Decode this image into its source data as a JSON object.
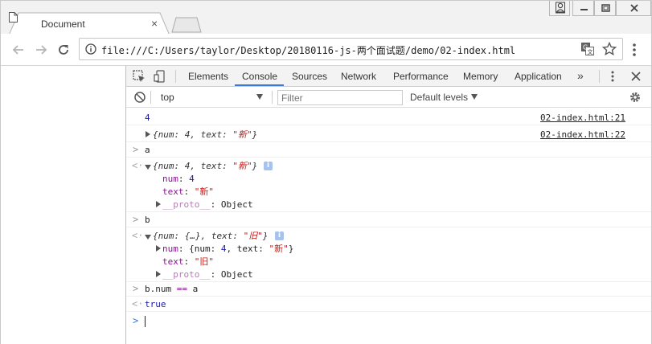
{
  "tab": {
    "title": "Document",
    "close": "×"
  },
  "address": {
    "url": "file:///C:/Users/taylor/Desktop/20180116-js-两个面试题/demo/02-index.html"
  },
  "icons": {
    "back": "arrow-left-icon",
    "forward": "arrow-right-icon",
    "reload": "reload-icon",
    "info": "info-icon",
    "translate": "translate-icon",
    "star": "star-icon",
    "menu": "kebab-menu-icon",
    "user": "user-icon",
    "minimize": "minimize-icon",
    "restore": "restore-icon",
    "close": "close-icon"
  },
  "devtools": {
    "tabs": [
      "Elements",
      "Console",
      "Sources",
      "Network",
      "Performance",
      "Memory",
      "Application"
    ],
    "active_tab": "Console",
    "more": "»",
    "context": "top",
    "filter_placeholder": "Filter",
    "levels": "Default levels"
  },
  "console": {
    "log1": {
      "value": "4",
      "source": "02-index.html:21"
    },
    "log2": {
      "text_prefix": "{num: 4, text: ",
      "text_str": "\"新\"",
      "text_suffix": "}",
      "source": "02-index.html:22"
    },
    "cmd_a": "a",
    "res_a": {
      "summary_prefix": "{num: 4, text: ",
      "summary_str": "\"新\"",
      "summary_suffix": "}",
      "badge": "i",
      "prop_num_key": "num",
      "prop_num_val": "4",
      "prop_text_key": "text",
      "prop_text_val": "\"新\"",
      "proto_key": "__proto__",
      "proto_val": "Object"
    },
    "cmd_b": "b",
    "res_b": {
      "summary_prefix": "{num: {…}, text: ",
      "summary_str": "\"旧\"",
      "summary_suffix": "}",
      "badge": "i",
      "prop_num_key": "num",
      "prop_num_val_prefix": "{num: ",
      "prop_num_val_num": "4",
      "prop_num_val_mid": ", text: ",
      "prop_num_val_str": "\"新\"",
      "prop_num_val_suffix": "}",
      "prop_text_key": "text",
      "prop_text_val": "\"旧\"",
      "proto_key": "__proto__",
      "proto_val": "Object"
    },
    "cmd_cmp_lhs": "b.num",
    "cmd_cmp_op": "==",
    "cmd_cmp_rhs": "a",
    "res_cmp": "true",
    "prompt_symbol": ">",
    "result_symbol": "<·"
  }
}
